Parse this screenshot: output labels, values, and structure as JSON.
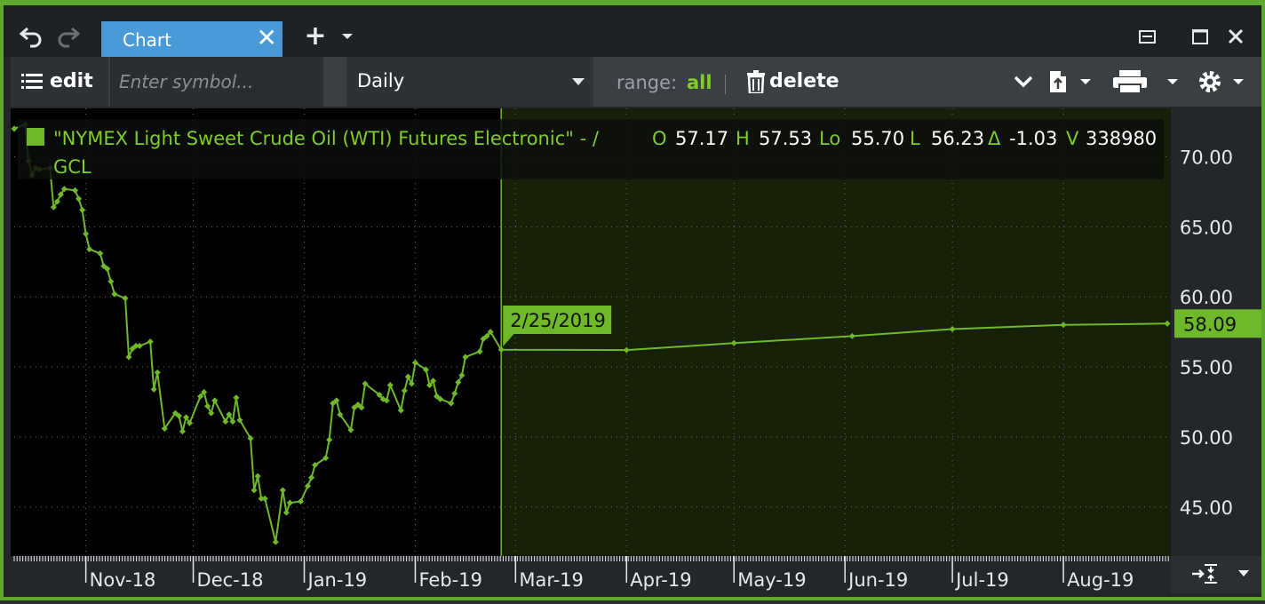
{
  "window": {
    "tab_label": "Chart",
    "tab_close_glyph": "✕",
    "add_glyph": "+",
    "icons": [
      "undo-icon",
      "redo-icon",
      "add-icon",
      "caret-down-icon",
      "restore-icon",
      "maximize-icon",
      "close-icon"
    ]
  },
  "toolbar": {
    "edit_label": "edit",
    "symbol_placeholder": "Enter symbol...",
    "period": "Daily",
    "range_label": "range:",
    "range_value": "all",
    "delete_label": "delete",
    "icons": [
      "menu-icon",
      "caret-down-icon",
      "trash-icon",
      "chevron-down-icon",
      "export-icon",
      "print-icon",
      "gear-icon"
    ]
  },
  "legend": {
    "title": "\"NYMEX Light Sweet Crude Oil (WTI) Futures Electronic\" - /",
    "symbol": "GCL",
    "o_label": "O",
    "o_value": "57.17",
    "h_label": "H",
    "h_value": "57.53",
    "lo_label": "Lo",
    "lo_value": "55.70",
    "l_label": "L",
    "l_value": "56.23",
    "d_label": "Δ",
    "d_value": "-1.03",
    "v_label": "V",
    "v_value": "338980"
  },
  "colors": {
    "accent": "#5fa82e",
    "line": "#6fb82a",
    "text_green": "#7fcc2a",
    "chart_bg": "#000000",
    "forecast_bg": "#162008",
    "tab_blue": "#4a9ad8"
  },
  "cursor_date": "2/25/2019",
  "last_price_label": "58.09",
  "chart_data": {
    "type": "line",
    "title": "\"NYMEX Light Sweet Crude Oil (WTI) Futures Electronic\" - /",
    "xlabel": "",
    "ylabel": "",
    "ylim": [
      41.5,
      73.2
    ],
    "y_ticks": [
      "70.00",
      "65.00",
      "60.00",
      "55.00",
      "50.00",
      "45.00"
    ],
    "y_tick_values": [
      70,
      65,
      60,
      55,
      50,
      45
    ],
    "x_ticks": [
      "Nov-18",
      "Dec-18",
      "Jan-19",
      "Feb-19",
      "Mar-19",
      "Apr-19",
      "May-19",
      "Jun-19",
      "Jul-19",
      "Aug-19"
    ],
    "x_tick_dates": [
      "2018-11-01",
      "2018-12-01",
      "2019-01-01",
      "2019-02-01",
      "2019-03-01",
      "2019-04-01",
      "2019-05-01",
      "2019-06-01",
      "2019-07-01",
      "2019-08-01"
    ],
    "x_range": [
      "2018-10-12",
      "2019-08-31"
    ],
    "grid": true,
    "series": [
      {
        "name": "GCL",
        "x": [
          "2018-10-12",
          "2018-10-15",
          "2018-10-16",
          "2018-10-17",
          "2018-10-18",
          "2018-10-19",
          "2018-10-22",
          "2018-10-23",
          "2018-10-24",
          "2018-10-25",
          "2018-10-26",
          "2018-10-29",
          "2018-10-30",
          "2018-10-31",
          "2018-11-01",
          "2018-11-02",
          "2018-11-05",
          "2018-11-06",
          "2018-11-07",
          "2018-11-08",
          "2018-11-09",
          "2018-11-12",
          "2018-11-13",
          "2018-11-14",
          "2018-11-15",
          "2018-11-16",
          "2018-11-19",
          "2018-11-20",
          "2018-11-21",
          "2018-11-23",
          "2018-11-26",
          "2018-11-27",
          "2018-11-28",
          "2018-11-29",
          "2018-11-30",
          "2018-12-03",
          "2018-12-04",
          "2018-12-05",
          "2018-12-06",
          "2018-12-07",
          "2018-12-10",
          "2018-12-11",
          "2018-12-12",
          "2018-12-13",
          "2018-12-14",
          "2018-12-17",
          "2018-12-18",
          "2018-12-19",
          "2018-12-20",
          "2018-12-21",
          "2018-12-24",
          "2018-12-26",
          "2018-12-27",
          "2018-12-28",
          "2018-12-31",
          "2019-01-02",
          "2019-01-03",
          "2019-01-04",
          "2019-01-07",
          "2019-01-08",
          "2019-01-09",
          "2019-01-10",
          "2019-01-11",
          "2019-01-14",
          "2019-01-15",
          "2019-01-16",
          "2019-01-17",
          "2019-01-18",
          "2019-01-22",
          "2019-01-23",
          "2019-01-24",
          "2019-01-25",
          "2019-01-28",
          "2019-01-29",
          "2019-01-30",
          "2019-01-31",
          "2019-02-01",
          "2019-02-04",
          "2019-02-05",
          "2019-02-06",
          "2019-02-07",
          "2019-02-08",
          "2019-02-11",
          "2019-02-12",
          "2019-02-13",
          "2019-02-14",
          "2019-02-15",
          "2019-02-19",
          "2019-02-20",
          "2019-02-21",
          "2019-02-22",
          "2019-02-25",
          "2019-04-01",
          "2019-05-01",
          "2019-06-03",
          "2019-07-01",
          "2019-08-01",
          "2019-08-30"
        ],
        "y": [
          72.0,
          72.3,
          69.7,
          68.7,
          69.2,
          69.1,
          69.2,
          66.4,
          66.8,
          67.3,
          67.7,
          67.6,
          67.0,
          66.2,
          64.5,
          63.4,
          63.1,
          62.2,
          62.0,
          61.1,
          60.2,
          59.9,
          55.7,
          56.3,
          56.5,
          56.5,
          56.8,
          53.4,
          54.6,
          50.6,
          51.7,
          51.5,
          50.4,
          51.4,
          51.0,
          52.9,
          53.2,
          52.2,
          51.7,
          52.6,
          51.1,
          51.6,
          51.1,
          52.8,
          51.2,
          49.9,
          46.2,
          47.2,
          45.6,
          45.6,
          42.5,
          46.2,
          44.6,
          45.3,
          45.4,
          46.5,
          47.1,
          48.0,
          48.5,
          49.8,
          52.4,
          52.6,
          51.6,
          50.5,
          52.1,
          52.3,
          52.1,
          53.8,
          53.0,
          52.7,
          52.6,
          53.7,
          51.9,
          53.3,
          54.3,
          53.8,
          55.3,
          54.8,
          53.7,
          54.0,
          52.9,
          52.7,
          52.4,
          53.1,
          53.9,
          54.4,
          55.7,
          56.1,
          57.0,
          57.2,
          57.5,
          56.23,
          56.2,
          56.7,
          57.2,
          57.7,
          58.0,
          58.09
        ]
      }
    ],
    "forecast_start": "2019-02-25"
  }
}
